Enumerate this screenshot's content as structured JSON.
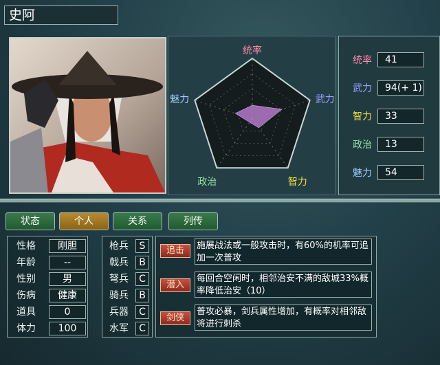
{
  "general": {
    "name": "史阿"
  },
  "radar": {
    "labels": [
      "统率",
      "武力",
      "智力",
      "政治",
      "魅力"
    ],
    "label_colors": [
      "#ff8aa8",
      "#9aa0ff",
      "#f0e040",
      "#90e0a0",
      "#a0d0ff"
    ],
    "max": 100,
    "values": [
      41,
      94,
      33,
      13,
      54
    ]
  },
  "stats": [
    {
      "label": "统率",
      "value": "41",
      "color": "#ff8aa8"
    },
    {
      "label": "武力",
      "value": "94(+ 1)",
      "color": "#9aa0ff"
    },
    {
      "label": "智力",
      "value": "33",
      "color": "#f0e040"
    },
    {
      "label": "政治",
      "value": "13",
      "color": "#90e0a0"
    },
    {
      "label": "魅力",
      "value": "54",
      "color": "#a0d0ff"
    }
  ],
  "tabs": [
    {
      "label": "状态",
      "active": false
    },
    {
      "label": "个人",
      "active": true
    },
    {
      "label": "关系",
      "active": false
    },
    {
      "label": "列传",
      "active": false
    }
  ],
  "profile": [
    {
      "label": "性格",
      "value": "刚胆"
    },
    {
      "label": "年龄",
      "value": "--"
    },
    {
      "label": "性别",
      "value": "男"
    },
    {
      "label": "伤病",
      "value": "健康"
    },
    {
      "label": "道具",
      "value": "0"
    },
    {
      "label": "体力",
      "value": "100"
    }
  ],
  "aptitudes": [
    {
      "label": "枪兵",
      "grade": "S"
    },
    {
      "label": "戟兵",
      "grade": "B"
    },
    {
      "label": "弩兵",
      "grade": "C"
    },
    {
      "label": "骑兵",
      "grade": "B"
    },
    {
      "label": "兵器",
      "grade": "C"
    },
    {
      "label": "水军",
      "grade": "C"
    }
  ],
  "skills": [
    {
      "name": "追击",
      "desc": "施展战法或一般攻击时，有60%的机率可追加一次普攻"
    },
    {
      "name": "潜入",
      "desc": "每回合空闲时，相邻治安不满的敌城33%概率降低治安（10）"
    },
    {
      "name": "剑侠",
      "desc": "普攻必暴，剑兵属性增加，有概率对相邻敌将进行刺杀"
    }
  ]
}
